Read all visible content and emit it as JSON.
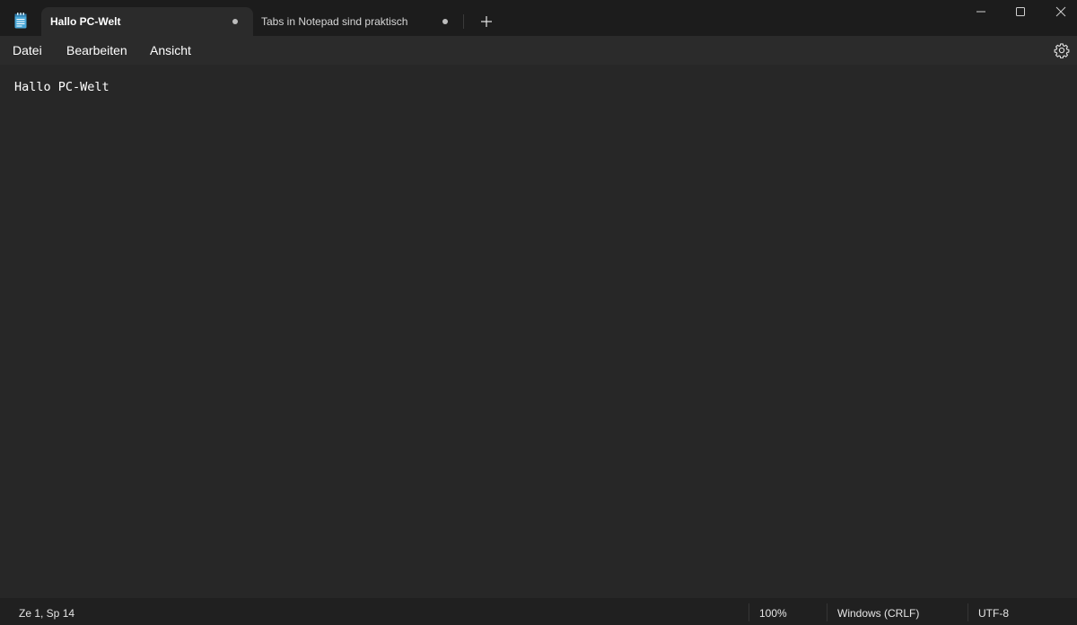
{
  "tabs": [
    {
      "label": "Hallo PC-Welt",
      "active": true,
      "unsaved": true
    },
    {
      "label": "Tabs in Notepad sind praktisch",
      "active": false,
      "unsaved": true
    }
  ],
  "new_tab_icon": "plus-icon",
  "app_icon": "notepad-icon",
  "window_controls": [
    "minimize-icon",
    "maximize-icon",
    "close-icon"
  ],
  "menu": {
    "file": "Datei",
    "edit": "Bearbeiten",
    "view": "Ansicht",
    "settings_icon": "gear-icon"
  },
  "editor": {
    "content": "Hallo PC-Welt"
  },
  "status": {
    "position": "Ze 1, Sp 14",
    "zoom": "100%",
    "line_ending": "Windows (CRLF)",
    "encoding": "UTF-8"
  },
  "colors": {
    "titlebar": "#1c1c1c",
    "active_tab": "#2b2b2b",
    "menubar": "#2b2b2b",
    "editor": "#272727",
    "statusbar": "#202020"
  }
}
